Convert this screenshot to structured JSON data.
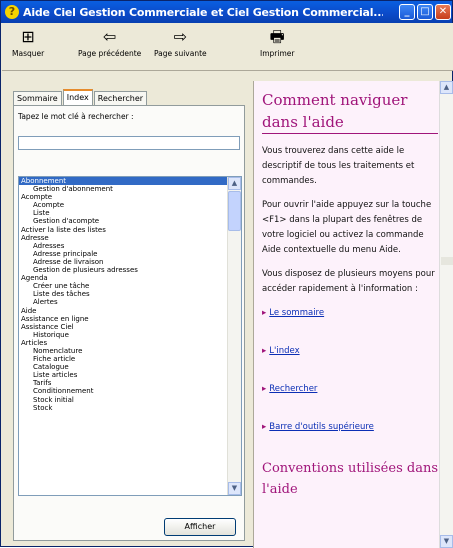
{
  "window": {
    "title": "Aide Ciel Gestion Commerciale et Ciel Gestion Commercial...",
    "minimize": "_",
    "maximize": "□",
    "close": "✕"
  },
  "toolbar": {
    "items": [
      {
        "label": "Masquer",
        "icon": "hide-icon",
        "glyph": "⊞"
      },
      {
        "label": "Page précédente",
        "icon": "back-arrow-icon",
        "glyph": "⇦"
      },
      {
        "label": "Page suivante",
        "icon": "forward-arrow-icon",
        "glyph": "⇨"
      },
      {
        "label": "Imprimer",
        "icon": "print-icon",
        "glyph": "🖶"
      }
    ]
  },
  "tabs": [
    "Sommaire",
    "Index",
    "Rechercher"
  ],
  "active_tab": "Index",
  "index": {
    "keyword_label": "Tapez le mot clé à rechercher :",
    "keyword_value": "",
    "items": [
      {
        "text": "Abonnement",
        "level": 0,
        "selected": true
      },
      {
        "text": "Gestion d'abonnement",
        "level": 1
      },
      {
        "text": "Acompte",
        "level": 0
      },
      {
        "text": "Acompte",
        "level": 1
      },
      {
        "text": "Liste",
        "level": 1
      },
      {
        "text": "Gestion d'acompte",
        "level": 1
      },
      {
        "text": "Activer la liste des listes",
        "level": 0
      },
      {
        "text": "Adresse",
        "level": 0
      },
      {
        "text": "Adresses",
        "level": 1
      },
      {
        "text": "Adresse principale",
        "level": 1
      },
      {
        "text": "Adresse de livraison",
        "level": 1
      },
      {
        "text": "Gestion de plusieurs adresses",
        "level": 1
      },
      {
        "text": "Agenda",
        "level": 0
      },
      {
        "text": "Créer une tâche",
        "level": 1
      },
      {
        "text": "Liste des tâches",
        "level": 1
      },
      {
        "text": "Alertes",
        "level": 1
      },
      {
        "text": "Aide",
        "level": 0
      },
      {
        "text": "Assistance en ligne",
        "level": 0
      },
      {
        "text": "Assistance Ciel",
        "level": 0
      },
      {
        "text": "Historique",
        "level": 1
      },
      {
        "text": "Articles",
        "level": 0
      },
      {
        "text": "Nomenclature",
        "level": 1
      },
      {
        "text": "Fiche article",
        "level": 1
      },
      {
        "text": "Catalogue",
        "level": 1
      },
      {
        "text": "Liste articles",
        "level": 1
      },
      {
        "text": "Tarifs",
        "level": 1
      },
      {
        "text": "Conditionnement",
        "level": 1
      },
      {
        "text": "Stock initial",
        "level": 1
      },
      {
        "text": "Stock",
        "level": 1
      }
    ],
    "show_button": "Afficher"
  },
  "help": {
    "title": "Comment naviguer dans l'aide",
    "paragraphs": [
      "Vous trouverez dans cette aide le descriptif de tous les traitements et commandes.",
      "Pour ouvrir l'aide appuyez sur la touche <F1> dans la plupart des fenêtres de votre logiciel ou activez la commande Aide contextuelle du menu Aide.",
      "Vous disposez de plusieurs moyens pour accéder rapidement à l'information :"
    ],
    "links": [
      "Le sommaire",
      "L'index",
      "Rechercher",
      "Barre d'outils supérieure"
    ],
    "subtitle": "Conventions utilisées dans l'aide"
  }
}
